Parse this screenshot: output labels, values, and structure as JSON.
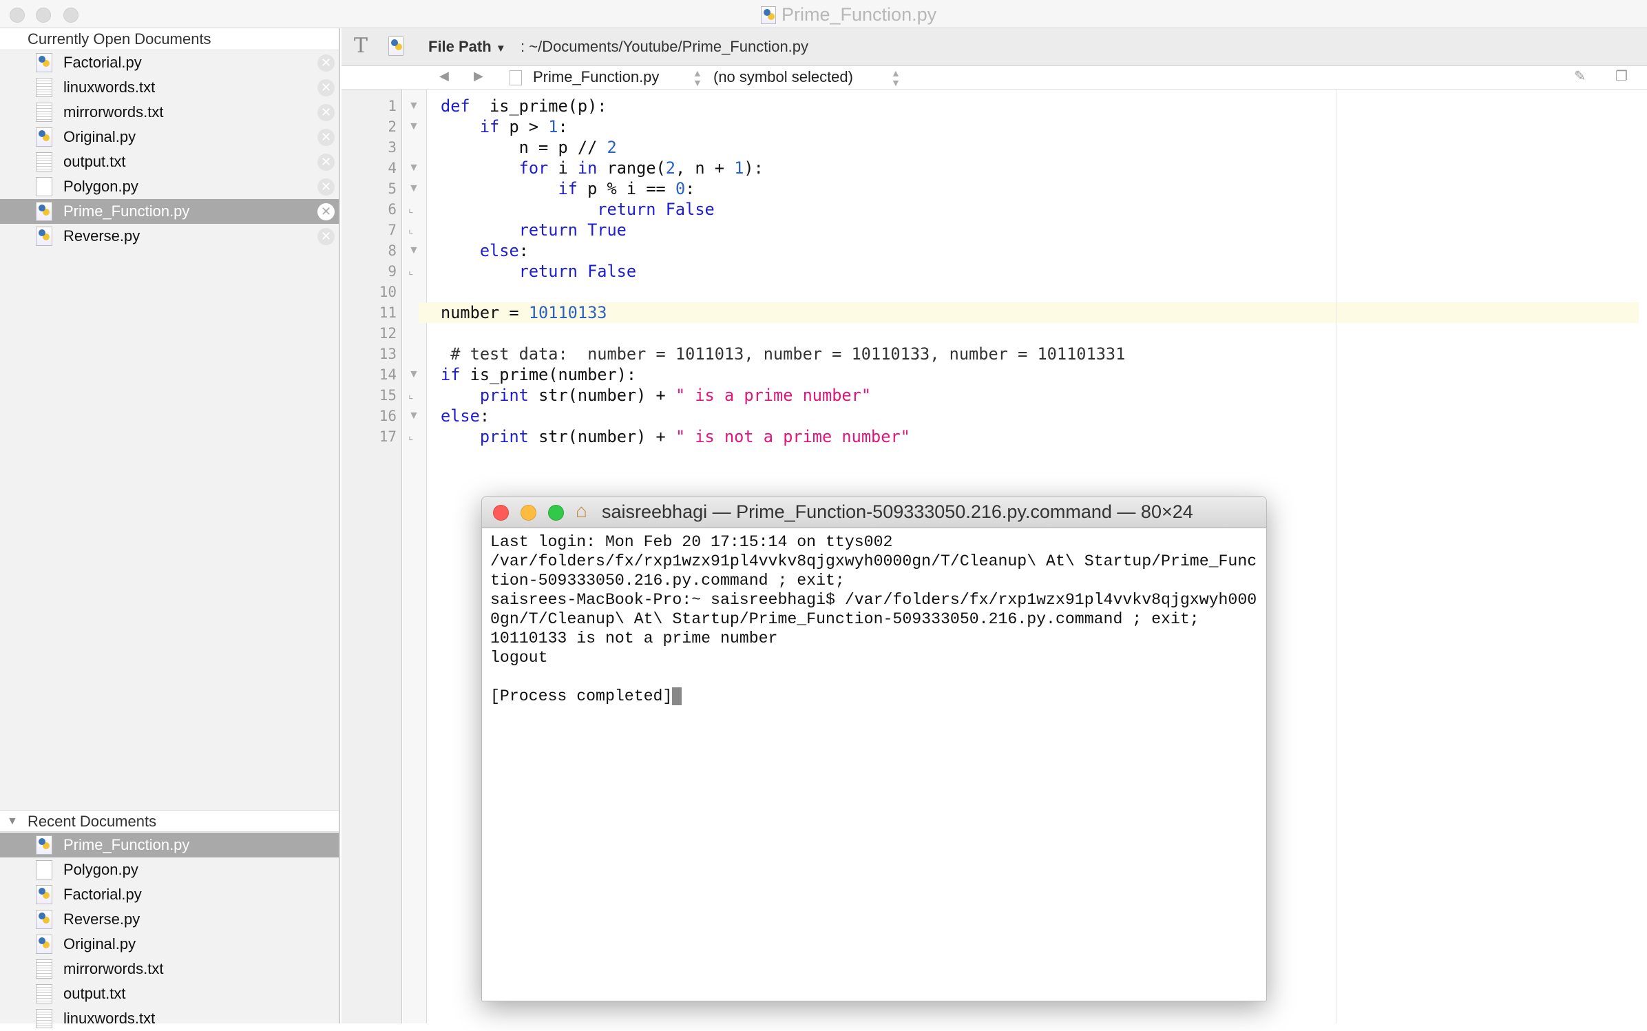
{
  "window": {
    "title": "Prime_Function.py"
  },
  "sidebar": {
    "open_header": "Currently Open Documents",
    "open_docs": [
      {
        "label": "Factorial.py",
        "icon": "python-file-icon"
      },
      {
        "label": "linuxwords.txt",
        "icon": "text-file-icon"
      },
      {
        "label": "mirrorwords.txt",
        "icon": "text-file-icon"
      },
      {
        "label": "Original.py",
        "icon": "python-file-icon"
      },
      {
        "label": "output.txt",
        "icon": "text-file-icon"
      },
      {
        "label": "Polygon.py",
        "icon": "blank-file-icon"
      },
      {
        "label": "Prime_Function.py",
        "icon": "python-file-icon",
        "selected": true
      },
      {
        "label": "Reverse.py",
        "icon": "python-file-icon"
      }
    ],
    "recent_header": "Recent Documents",
    "recent_docs": [
      {
        "label": "Prime_Function.py",
        "icon": "python-file-icon",
        "selected": true
      },
      {
        "label": "Polygon.py",
        "icon": "blank-file-icon"
      },
      {
        "label": "Factorial.py",
        "icon": "python-file-icon"
      },
      {
        "label": "Reverse.py",
        "icon": "python-file-icon"
      },
      {
        "label": "Original.py",
        "icon": "python-file-icon"
      },
      {
        "label": "mirrorwords.txt",
        "icon": "text-file-icon"
      },
      {
        "label": "output.txt",
        "icon": "text-file-icon"
      },
      {
        "label": "linuxwords.txt",
        "icon": "text-file-icon"
      }
    ]
  },
  "toolbar": {
    "file_path_label": "File Path",
    "file_path": ": ~/Documents/Youtube/Prime_Function.py"
  },
  "navbar": {
    "file": "Prime_Function.py",
    "symbol": "(no symbol selected)"
  },
  "editor": {
    "current_line": 11,
    "lines": [
      [
        [
          "kw",
          "def"
        ],
        [
          "",
          "  is_prime(p):"
        ]
      ],
      [
        [
          "",
          "    "
        ],
        [
          "kw",
          "if"
        ],
        [
          "",
          " p > "
        ],
        [
          "num",
          "1"
        ],
        [
          "",
          ":"
        ]
      ],
      [
        [
          "",
          "        n = p // "
        ],
        [
          "num",
          "2"
        ]
      ],
      [
        [
          "",
          "        "
        ],
        [
          "kw",
          "for"
        ],
        [
          "",
          " i "
        ],
        [
          "kw",
          "in"
        ],
        [
          "",
          " range("
        ],
        [
          "num",
          "2"
        ],
        [
          "",
          ", n + "
        ],
        [
          "num",
          "1"
        ],
        [
          "",
          "):"
        ]
      ],
      [
        [
          "",
          "            "
        ],
        [
          "kw",
          "if"
        ],
        [
          "",
          " p % i == "
        ],
        [
          "num",
          "0"
        ],
        [
          "",
          ":"
        ]
      ],
      [
        [
          "",
          "                "
        ],
        [
          "kw",
          "return False"
        ]
      ],
      [
        [
          "",
          "        "
        ],
        [
          "kw",
          "return True"
        ]
      ],
      [
        [
          "",
          "    "
        ],
        [
          "kw",
          "else"
        ],
        [
          "",
          ":"
        ]
      ],
      [
        [
          "",
          "        "
        ],
        [
          "kw",
          "return False"
        ]
      ],
      [],
      [
        [
          "",
          "number = "
        ],
        [
          "num",
          "10110133"
        ]
      ],
      [],
      [
        [
          "cmt",
          " # test data:  number = 1011013, number = 10110133, number = 101101331"
        ]
      ],
      [
        [
          "kw",
          "if"
        ],
        [
          "",
          " is_prime(number):"
        ]
      ],
      [
        [
          "",
          "    "
        ],
        [
          "kw",
          "print"
        ],
        [
          "",
          " str(number) + "
        ],
        [
          "str",
          "\" is a prime number\""
        ]
      ],
      [
        [
          "kw",
          "else"
        ],
        [
          "",
          ":"
        ]
      ],
      [
        [
          "",
          "    "
        ],
        [
          "kw",
          "print"
        ],
        [
          "",
          " str(number) + "
        ],
        [
          "str",
          "\" is not a prime number\""
        ]
      ]
    ],
    "folds": {
      "1": "open",
      "2": "open",
      "4": "open",
      "5": "open",
      "6": "end",
      "7": "end",
      "8": "open",
      "9": "end",
      "14": "open",
      "15": "end",
      "16": "open",
      "17": "end"
    }
  },
  "terminal": {
    "title": "saisreebhagi — Prime_Function-509333050.216.py.command — 80×24",
    "lines": [
      "Last login: Mon Feb 20 17:15:14 on ttys002",
      "/var/folders/fx/rxp1wzx91pl4vvkv8qjgxwyh0000gn/T/Cleanup\\ At\\ Startup/Prime_Func",
      "tion-509333050.216.py.command ; exit;",
      "saisrees-MacBook-Pro:~ saisreebhagi$ /var/folders/fx/rxp1wzx91pl4vvkv8qjgxwyh000",
      "0gn/T/Cleanup\\ At\\ Startup/Prime_Function-509333050.216.py.command ; exit;",
      "10110133 is not a prime number",
      "logout",
      "",
      "[Process completed]"
    ]
  },
  "colors": {
    "keyword": "#1d1dd1",
    "number": "#2a62c4",
    "string": "#e0147a",
    "current_line": "#fdfbe3",
    "selection": "#a9a9a9"
  }
}
